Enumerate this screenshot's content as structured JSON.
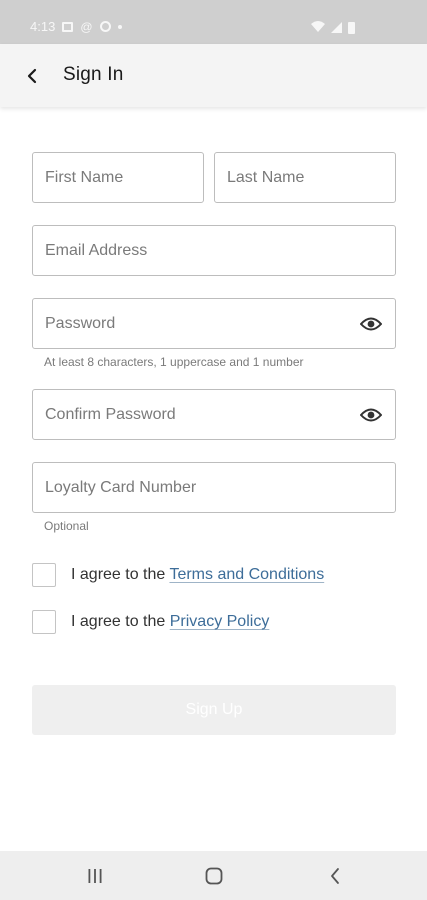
{
  "status_bar": {
    "time": "4:13",
    "icons": [
      "photo-icon",
      "at-icon",
      "blocked-icon",
      "dot-icon",
      "wifi-icon",
      "signal-icon",
      "battery-icon"
    ]
  },
  "header": {
    "back_icon": "chevron-left-icon",
    "title": "Sign In"
  },
  "form": {
    "first_name": {
      "placeholder": "First Name",
      "value": ""
    },
    "last_name": {
      "placeholder": "Last Name",
      "value": ""
    },
    "email": {
      "placeholder": "Email Address",
      "value": ""
    },
    "password": {
      "placeholder": "Password",
      "value": "",
      "helper": "At least 8 characters, 1 uppercase and 1 number",
      "toggle_icon": "eye-icon"
    },
    "confirm_password": {
      "placeholder": "Confirm Password",
      "value": "",
      "toggle_icon": "eye-icon"
    },
    "loyalty": {
      "placeholder": "Loyalty Card Number",
      "value": "",
      "helper": "Optional"
    }
  },
  "agreements": {
    "terms": {
      "prefix": "I agree to the ",
      "link": "Terms and Conditions",
      "checked": false
    },
    "privacy": {
      "prefix": "I agree to the ",
      "link": "Privacy Policy",
      "checked": false
    }
  },
  "signup": {
    "label": "Sign Up",
    "enabled": false
  },
  "nav": {
    "recents_icon": "recents-icon",
    "home_icon": "home-icon",
    "back_icon": "back-icon"
  },
  "colors": {
    "link": "#3d6d99",
    "status_bar_bg": "#cfcfcf",
    "app_bar_bg": "#f4f4f4",
    "field_border": "#bdbdbd",
    "disabled_button_bg": "#efefef",
    "nav_bar_bg": "#eeeeee"
  }
}
